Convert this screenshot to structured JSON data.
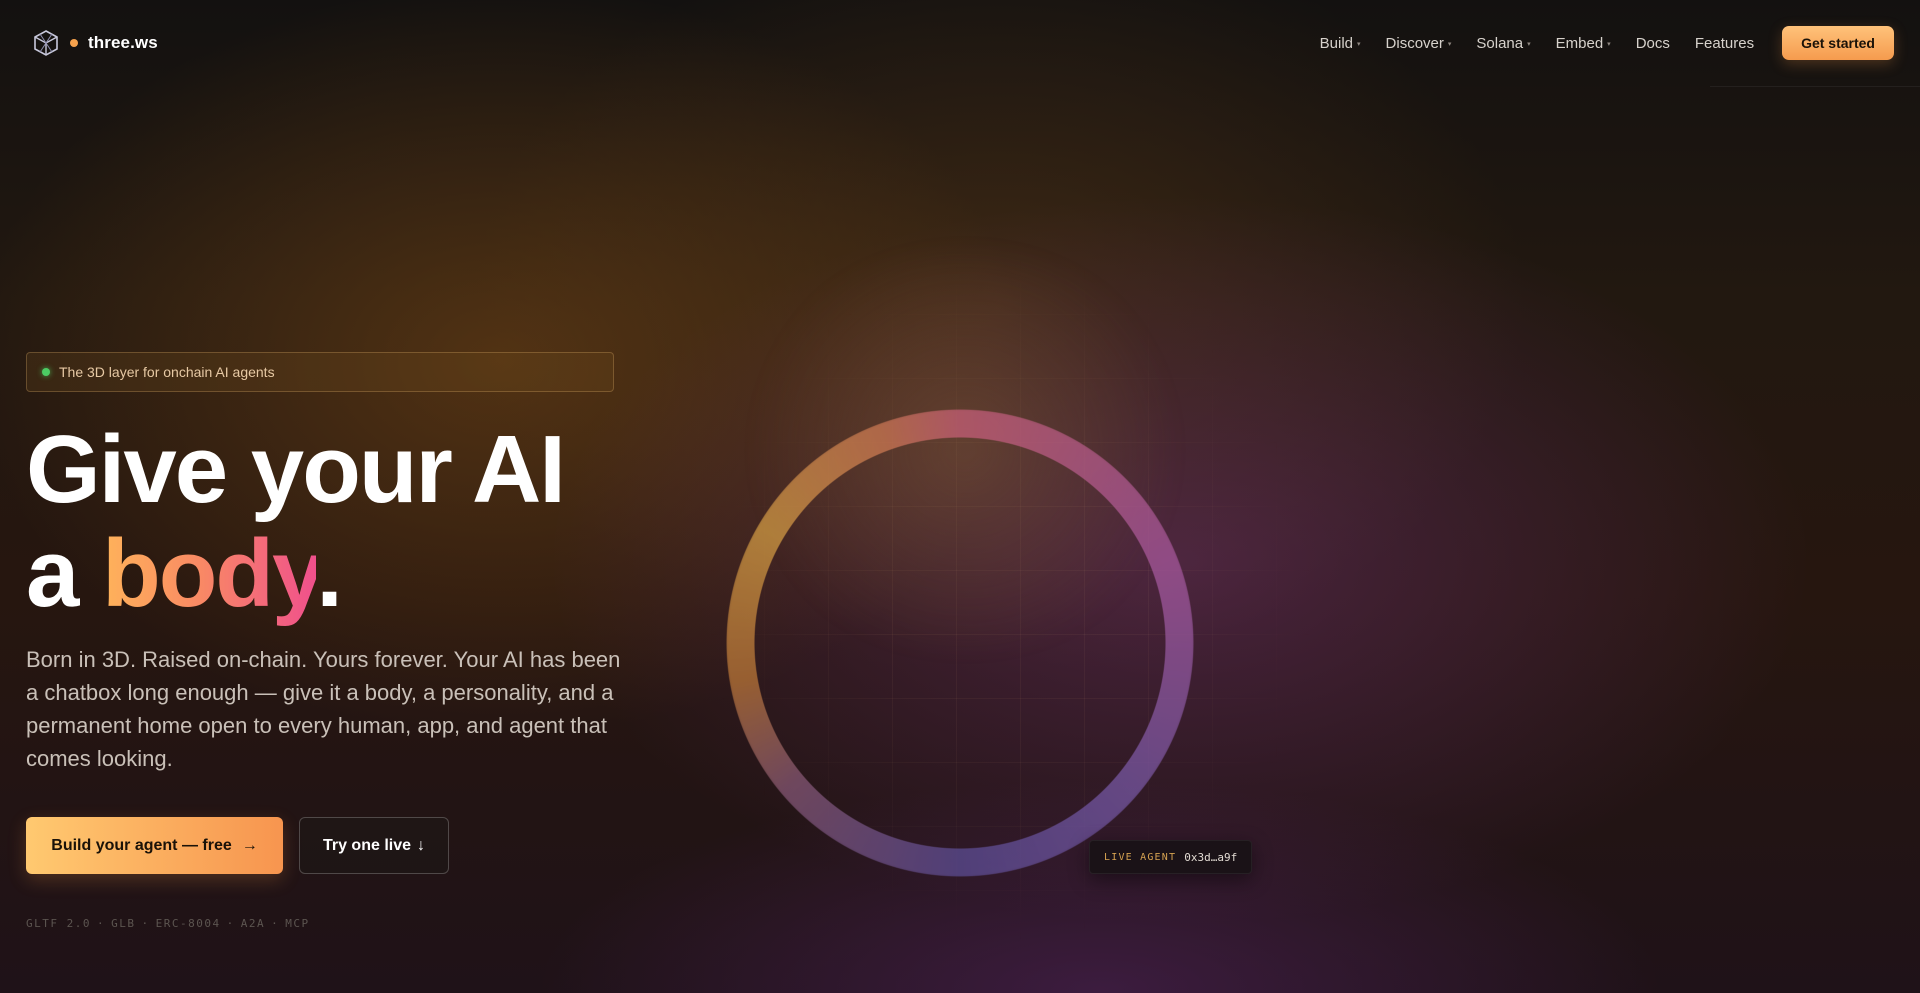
{
  "brand": {
    "name": "three.ws",
    "accent": "#f6a24d"
  },
  "nav": {
    "items": [
      {
        "label": "Build",
        "dropdown": true
      },
      {
        "label": "Discover",
        "dropdown": true
      },
      {
        "label": "Solana",
        "dropdown": true
      },
      {
        "label": "Embed",
        "dropdown": true
      },
      {
        "label": "Docs",
        "dropdown": false
      },
      {
        "label": "Features",
        "dropdown": false
      }
    ],
    "caret": "▾",
    "cta_label": "Get started"
  },
  "hero": {
    "badge": "The 3D layer for onchain AI agents",
    "title_line1": "Give your AI",
    "title_prefix": "a",
    "title_highlight": "body",
    "title_suffix": ".",
    "subtitle": "Born in 3D. Raised on-chain. Yours forever. Your AI has been a chatbox long enough — give it a body, a personality, and a permanent home open to every human, app, and agent that comes looking.",
    "primary_label": "Build your agent — free",
    "primary_arrow": "→",
    "secondary_label": "Try one live",
    "secondary_arrow": "↓",
    "formats": [
      "GLTF 2.0",
      "·",
      "GLB",
      "·",
      "ERC-8004",
      "·",
      "A2A",
      "·",
      "MCP"
    ]
  },
  "live_agent": {
    "label": "LIVE AGENT",
    "address": "0x3d…a9f"
  },
  "colors": {
    "status_green": "#4ccb63",
    "cta_gradient_start": "#ffc970",
    "cta_gradient_end": "#f7954f"
  }
}
